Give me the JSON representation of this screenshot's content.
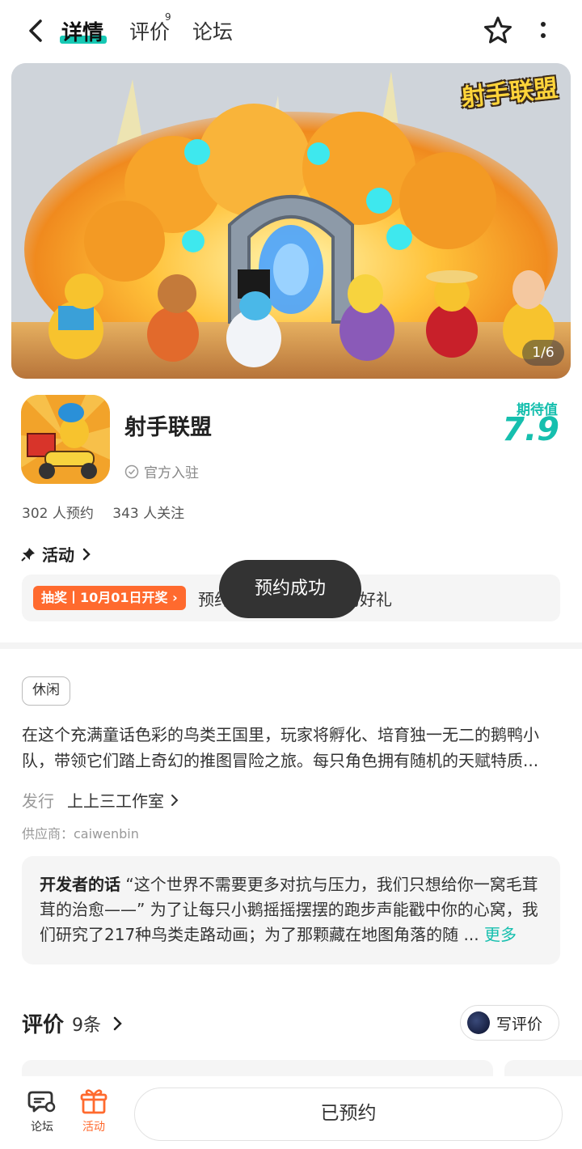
{
  "topbar": {
    "tabs": [
      {
        "label": "详情",
        "active": true
      },
      {
        "label": "评价",
        "badge": "9"
      },
      {
        "label": "论坛"
      }
    ],
    "icons": [
      "back-arrow-icon",
      "star-icon",
      "more-vertical-icon"
    ]
  },
  "banner": {
    "logo_text": "射手联盟",
    "page_indicator": "1/6"
  },
  "game": {
    "title": "射手联盟",
    "official_label": "官方入驻",
    "expect_label": "期待值",
    "expect_value": "7.9",
    "reservations": "302 人预约",
    "followers": "343 人关注"
  },
  "activity": {
    "header": "活动",
    "tag": "抽奖丨10月01日开奖",
    "text": "预约【射手联盟】预约好礼"
  },
  "toast": {
    "text": "预约成功"
  },
  "description": {
    "genre_tag": "休闲",
    "text": "在这个充满童话色彩的鸟类王国里，玩家将孵化、培育独一无二的鹅鸭小队，带领它们踏上奇幻的推图冒险之旅。每只角色拥有随机的天赋特质...",
    "publisher_label": "发行",
    "publisher": "上上三工作室",
    "supplier": "供应商：caiwenbin"
  },
  "developer": {
    "label": "开发者的话",
    "text": "“这个世界不需要更多对抗与压力，我们只想给你一窝毛茸茸的治愈——” 为了让每只小鹅摇摇摆摆的跑步声能戳中你的心窝，我们研究了217种鸟类走路动画；为了那颗藏在地图角落的随 ...",
    "more": "更多"
  },
  "reviews": {
    "title": "评价",
    "count": "9条",
    "write_button": "写评价"
  },
  "bottombar": {
    "forum_label": "论坛",
    "activity_label": "活动",
    "reserved_button": "已预约"
  },
  "colors": {
    "accent": "#16bfae",
    "tab_underline": "#16c8b4",
    "activity_orange": "#ff6a2e",
    "toast_bg": "#333333"
  }
}
